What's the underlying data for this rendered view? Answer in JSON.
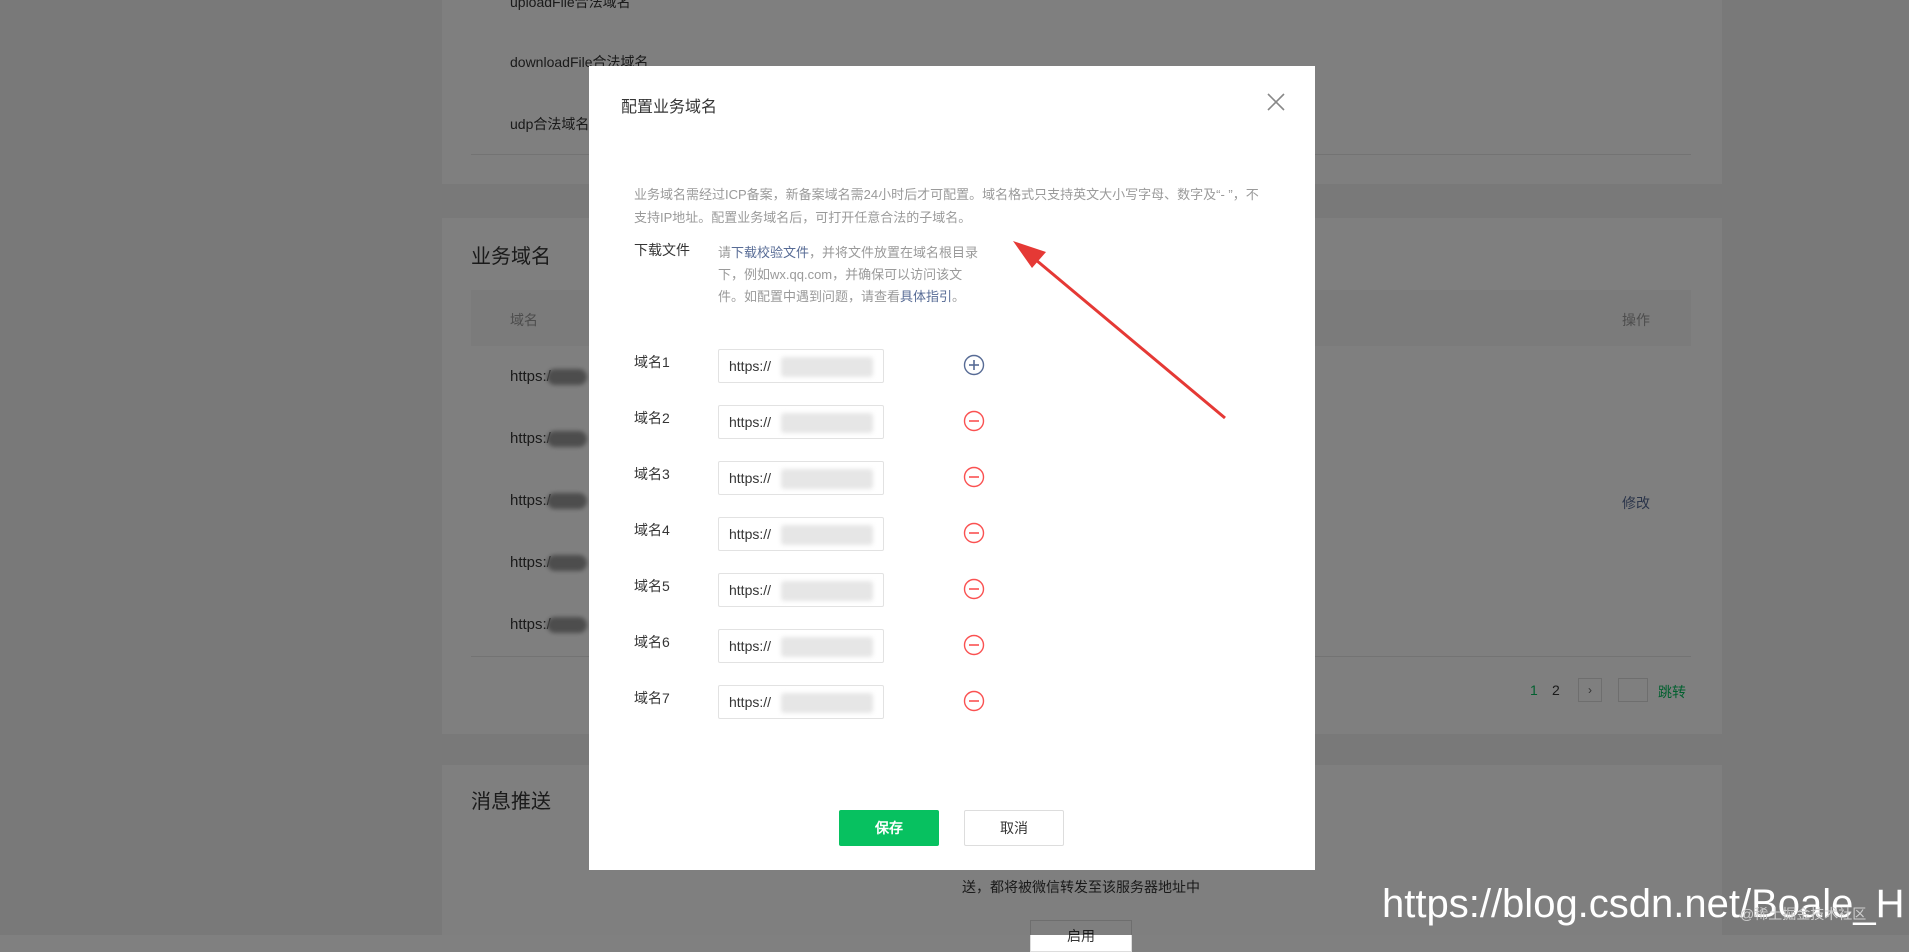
{
  "background": {
    "top_labels": [
      "uploadFile合法域名",
      "downloadFile合法域名",
      "udp合法域名"
    ],
    "section_business": "业务域名",
    "table_header_domain": "域名",
    "table_header_ops": "操作",
    "rows": [
      "https:/",
      "https:/",
      "https:/",
      "https:/",
      "https:/"
    ],
    "modify_label": "修改",
    "pager": {
      "page1": "1",
      "page2": "2",
      "next": "›",
      "jump": "跳转"
    },
    "section_message": "消息推送",
    "message_desc_line2": "送，都将被微信转发至该服务器地址中",
    "apply_button": "启用"
  },
  "modal": {
    "title": "配置业务域名",
    "notice": "业务域名需经过ICP备案，新备案域名需24小时后才可配置。域名格式只支持英文大小写字母、数字及“- ”，不支持IP地址。配置业务域名后，可打开任意合法的子域名。",
    "download": {
      "label": "下载文件",
      "part1": "请",
      "link1": "下载校验文件",
      "part2": "，并将文件放置在域名根目录下，例如wx.qq.com，并确保可以访问该文件。如配置中遇到问题，请查看",
      "link2": "具体指引",
      "part3": "。"
    },
    "domains": [
      {
        "label": "域名1",
        "prefix": "https://",
        "action": "add"
      },
      {
        "label": "域名2",
        "prefix": "https://",
        "action": "remove"
      },
      {
        "label": "域名3",
        "prefix": "https://",
        "action": "remove"
      },
      {
        "label": "域名4",
        "prefix": "https://",
        "action": "remove"
      },
      {
        "label": "域名5",
        "prefix": "https://",
        "action": "remove"
      },
      {
        "label": "域名6",
        "prefix": "https://",
        "action": "remove"
      },
      {
        "label": "域名7",
        "prefix": "https://",
        "action": "remove"
      }
    ],
    "save_label": "保存",
    "cancel_label": "取消"
  },
  "watermark": "https://blog.csdn.net/Boale_H",
  "watermark_small": "@稀土掘金技术社区",
  "colors": {
    "primary": "#07c160",
    "link": "#576b95",
    "danger": "#fa5151",
    "add": "#576b95",
    "arrow": "#e53935"
  }
}
